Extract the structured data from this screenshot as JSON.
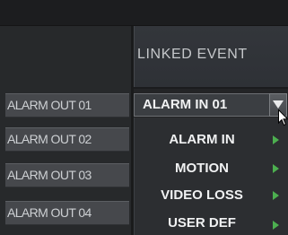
{
  "header": {
    "linked_event_label": "LINKED EVENT"
  },
  "alarm_outputs": [
    {
      "label": "ALARM OUT 01"
    },
    {
      "label": "ALARM OUT 02"
    },
    {
      "label": "ALARM OUT 03"
    },
    {
      "label": "ALARM OUT 04"
    }
  ],
  "linked_event_select": {
    "value": "ALARM IN 01"
  },
  "dropdown_menu": {
    "items": [
      {
        "label": "ALARM IN"
      },
      {
        "label": "MOTION"
      },
      {
        "label": "VIDEO LOSS"
      },
      {
        "label": "USER DEF"
      }
    ]
  },
  "colors": {
    "submenu_arrow": "#4caf4f",
    "background": "#232426"
  },
  "icons": {
    "dropdown": "triangle-down-icon",
    "submenu": "triangle-right-icon",
    "pointer": "mouse-pointer-icon"
  }
}
